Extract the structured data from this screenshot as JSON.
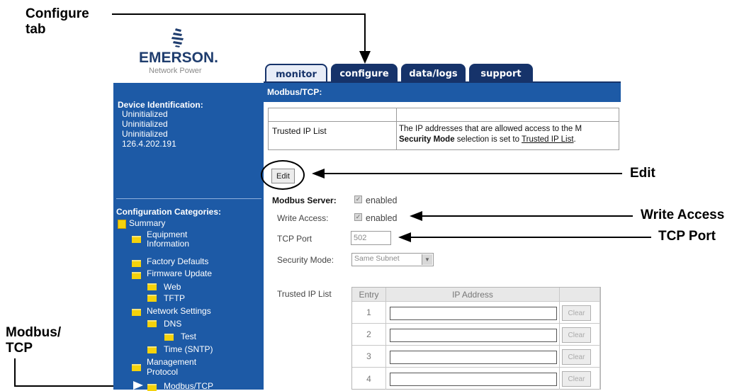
{
  "callouts": {
    "configure_tab_line1": "Configure",
    "configure_tab_line2": "tab",
    "edit": "Edit",
    "write_access": "Write Access",
    "tcp_port": "TCP Port",
    "modbus_tcp_line1": "Modbus/",
    "modbus_tcp_line2": "TCP"
  },
  "logo": {
    "brand": "EMERSON.",
    "subtitle": "Network Power"
  },
  "tabs": [
    {
      "label": "monitor",
      "active": true
    },
    {
      "label": "configure",
      "active": false
    },
    {
      "label": "data/logs",
      "active": false
    },
    {
      "label": "support",
      "active": false
    }
  ],
  "sidebar": {
    "device_heading": "Device Identification:",
    "device_lines": [
      "Uninitialized",
      "Uninitialized",
      "Uninitialized",
      "126.4.202.191"
    ],
    "config_heading": "Configuration Categories:",
    "items": [
      {
        "label": "Summary"
      },
      {
        "label": "Equipment"
      },
      {
        "label": "Information"
      },
      {
        "label": "Factory Defaults"
      },
      {
        "label": "Firmware Update"
      },
      {
        "label": "Web"
      },
      {
        "label": "TFTP"
      },
      {
        "label": "Network Settings"
      },
      {
        "label": "DNS"
      },
      {
        "label": "Test"
      },
      {
        "label": "Time (SNTP)"
      },
      {
        "label": "Management"
      },
      {
        "label": "Protocol"
      },
      {
        "label": "Modbus/TCP"
      }
    ]
  },
  "main": {
    "header": "Modbus/TCP:",
    "table": {
      "row_label": "Trusted IP List",
      "desc_line1": "The IP addresses that are allowed access to the M",
      "desc_line2_bold": "Security Mode",
      "desc_line2_mid": " selection is set to ",
      "desc_line2_link": "Trusted IP List",
      "desc_line2_end": "."
    },
    "edit_button": "Edit",
    "modbus_server_label": "Modbus Server:",
    "modbus_server_value": "enabled",
    "write_access_label": "Write Access:",
    "write_access_value": "enabled",
    "tcp_port_label": "TCP Port",
    "tcp_port_value": "502",
    "security_mode_label": "Security Mode:",
    "security_mode_value": "Same Subnet",
    "trusted_ip_label": "Trusted IP List",
    "ip_table": {
      "col_entry": "Entry",
      "col_ip": "IP Address",
      "rows": [
        {
          "entry": "1",
          "clear": "Clear"
        },
        {
          "entry": "2",
          "clear": "Clear"
        },
        {
          "entry": "3",
          "clear": "Clear"
        },
        {
          "entry": "4",
          "clear": "Clear"
        }
      ]
    }
  }
}
